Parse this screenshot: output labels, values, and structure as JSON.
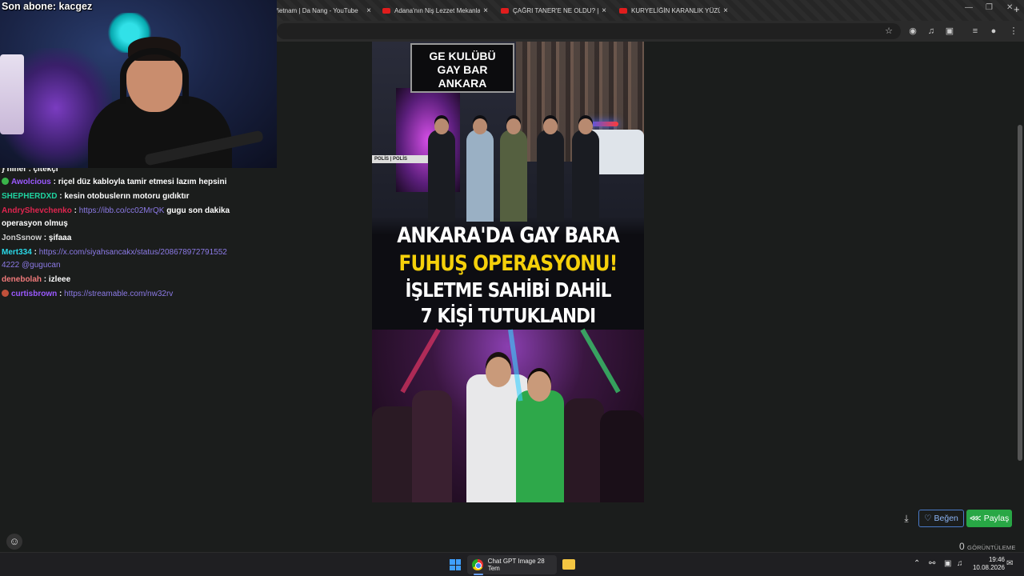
{
  "stream": {
    "last_subscriber": "Son abone: kacgez"
  },
  "browser": {
    "tabs": [
      {
        "title": "Vietnam | Da Nang - YouTube"
      },
      {
        "title": "Adana'nın Niş Lezzet Mekanları"
      },
      {
        "title": "ÇAĞRI TANER'E NE OLDU? | TÜ"
      },
      {
        "title": "KURYELİĞİN KARANLIK YÜZÜ: I"
      }
    ],
    "new_tab": "+",
    "close": "×"
  },
  "chat": {
    "cut_line": "} niner . çıtekçı",
    "messages": [
      {
        "user": "Awolcious",
        "color": "#9b59ff",
        "text": ": riçel düz kabloyla tamir etmesi lazım hepsini",
        "link": ""
      },
      {
        "user": "SHEPHERDXD",
        "color": "#1fd3a0",
        "text": ": kesin otobuslerın motoru gıdıktır",
        "link": ""
      },
      {
        "user": "AndryShevchenko",
        "color": "#e0254f",
        "text": "gugu son dakika operasyon olmuş",
        "link": "https://ibb.co/cc02MrQK"
      },
      {
        "user": "JonSsnow",
        "color": "#cfcfcf",
        "text": ": şifaaa",
        "link": ""
      },
      {
        "user": "Mert334",
        "color": "#2ad9e8",
        "text": "",
        "link": "https://x.com/siyahsancakx/status/2086789727915524222 @gugucan"
      },
      {
        "user": "denebolah",
        "color": "#f07a7a",
        "text": ": izleee",
        "link": ""
      },
      {
        "user": "curtisbrown",
        "color": "#9b59ff",
        "text": "",
        "link": "https://streamable.com/nw32rv"
      }
    ]
  },
  "poster": {
    "sign_line1": "GE KULÜBÜ",
    "sign_line2": "GAY BAR",
    "sign_line3": "ANKARA",
    "tape": "POLİS | POLİS",
    "headline1": "ANKARA'DA GAY BARA",
    "headline2": "FUHUŞ OPERASYONU!",
    "headline3": "İŞLETME SAHİBİ DAHİL",
    "headline4": "7 KİŞİ TUTUKLANDI"
  },
  "actions": {
    "download_icon": "⤓",
    "like_label": "Beğen",
    "share_label": "Paylaş",
    "views_count": "0",
    "views_label": "GÖRÜNTÜLEME"
  },
  "taskbar": {
    "chrome_label": "Chat GPT Image 28 Tem",
    "time": "19:46",
    "date": "10.08.2026"
  },
  "colors": {
    "like_border": "#4a7ac8",
    "share_bg": "#28a745",
    "headline_yellow": "#f5d00a"
  }
}
